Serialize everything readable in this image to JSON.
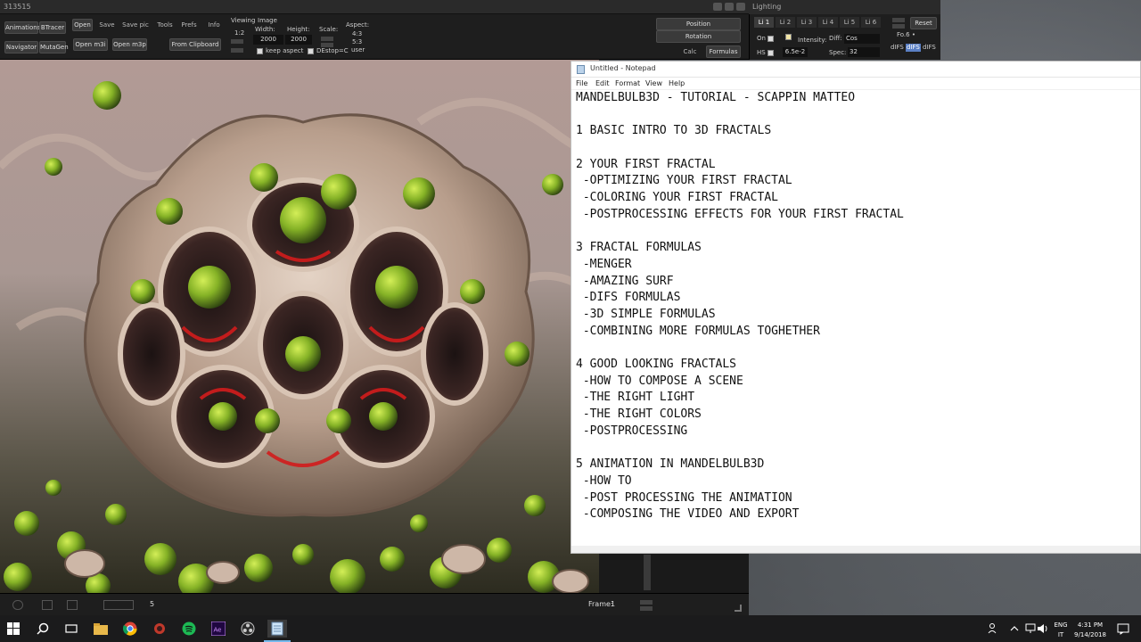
{
  "mandelbulb": {
    "window_title": "313515",
    "buttons": {
      "animations": "Animations",
      "btracer": "BTracer",
      "navigator": "Navigator",
      "mutagen": "MutaGen",
      "open": "Open",
      "save": "Save",
      "save_pic": "Save pic",
      "tools": "Tools",
      "prefs": "Prefs",
      "info": "Info",
      "open_m3i": "Open m3i",
      "open_m3p": "Open m3p",
      "from_clipboard": "From Clipboard",
      "position": "Position",
      "rotation": "Rotation",
      "calc": "Calc",
      "formulas": "Formulas"
    },
    "viewing_label": "Viewing",
    "viewing_value": "1:2",
    "image_label": "Image",
    "width_label": "Width:",
    "width_value": "2000",
    "height_label": "Height:",
    "height_value": "2000",
    "scale_label": "Scale:",
    "aspect_label": "Aspect:",
    "aspect_values": [
      "4:3",
      "5:3",
      "user"
    ],
    "keep_aspect": "keep aspect",
    "desktop_c": "DEstop=C",
    "status": {
      "zoom_value": "5",
      "frame_label": "Frame:",
      "frame_value": "1"
    }
  },
  "lighting": {
    "title": "Lighting",
    "tabs": [
      "Li 1",
      "Li 2",
      "Li 3",
      "Li 4",
      "Li 5",
      "Li 6"
    ],
    "active_tab": "Li 1",
    "reset": "Reset",
    "on_label": "On",
    "hs_label": "HS",
    "hs_value": "6.5e-2",
    "intensity_label": "Intensity:",
    "diff_label": "Diff:",
    "diff_value": "Cos",
    "spec_label": "Spec:",
    "spec_value": "32",
    "fo_label": "Fo.6 •",
    "difs_labels": [
      "dIFS",
      "dIFS",
      "dIFS"
    ]
  },
  "notepad": {
    "title": "Untitled - Notepad",
    "menu": [
      "File",
      "Edit",
      "Format",
      "View",
      "Help"
    ],
    "lines": [
      "MANDELBULB3D - TUTORIAL - SCAPPIN MATTEO",
      "",
      "1 BASIC INTRO TO 3D FRACTALS",
      "",
      "2 YOUR FIRST FRACTAL",
      " -OPTIMIZING YOUR FIRST FRACTAL",
      " -COLORING YOUR FIRST FRACTAL",
      " -POSTPROCESSING EFFECTS FOR YOUR FIRST FRACTAL",
      "",
      "3 FRACTAL FORMULAS",
      " -MENGER",
      " -AMAZING SURF",
      " -DIFS FORMULAS",
      " -3D SIMPLE FORMULAS",
      " -COMBINING MORE FORMULAS TOGHETHER",
      "",
      "4 GOOD LOOKING FRACTALS",
      " -HOW TO COMPOSE A SCENE",
      " -THE RIGHT LIGHT",
      " -THE RIGHT COLORS",
      " -POSTPROCESSING",
      "",
      "5 ANIMATION IN MANDELBULB3D",
      " -HOW TO",
      " -POST PROCESSING THE ANIMATION",
      " -COMPOSING THE VIDEO AND EXPORT"
    ]
  },
  "taskbar": {
    "lang": "ENG",
    "region": "IT",
    "time": "4:31 PM",
    "date": "9/14/2018",
    "apps": [
      "start-icon",
      "search-icon",
      "task-view-icon",
      "file-explorer-icon",
      "chrome-icon",
      "mandelbulb-icon",
      "spotify-icon",
      "after-effects-icon",
      "obs-icon",
      "notepad-icon"
    ]
  },
  "colors": {
    "accent": "#76b9ed",
    "fractal_green": "#8fbd2a",
    "fractal_red": "#d21c1c",
    "fractal_bone": "#cdb7a7"
  }
}
